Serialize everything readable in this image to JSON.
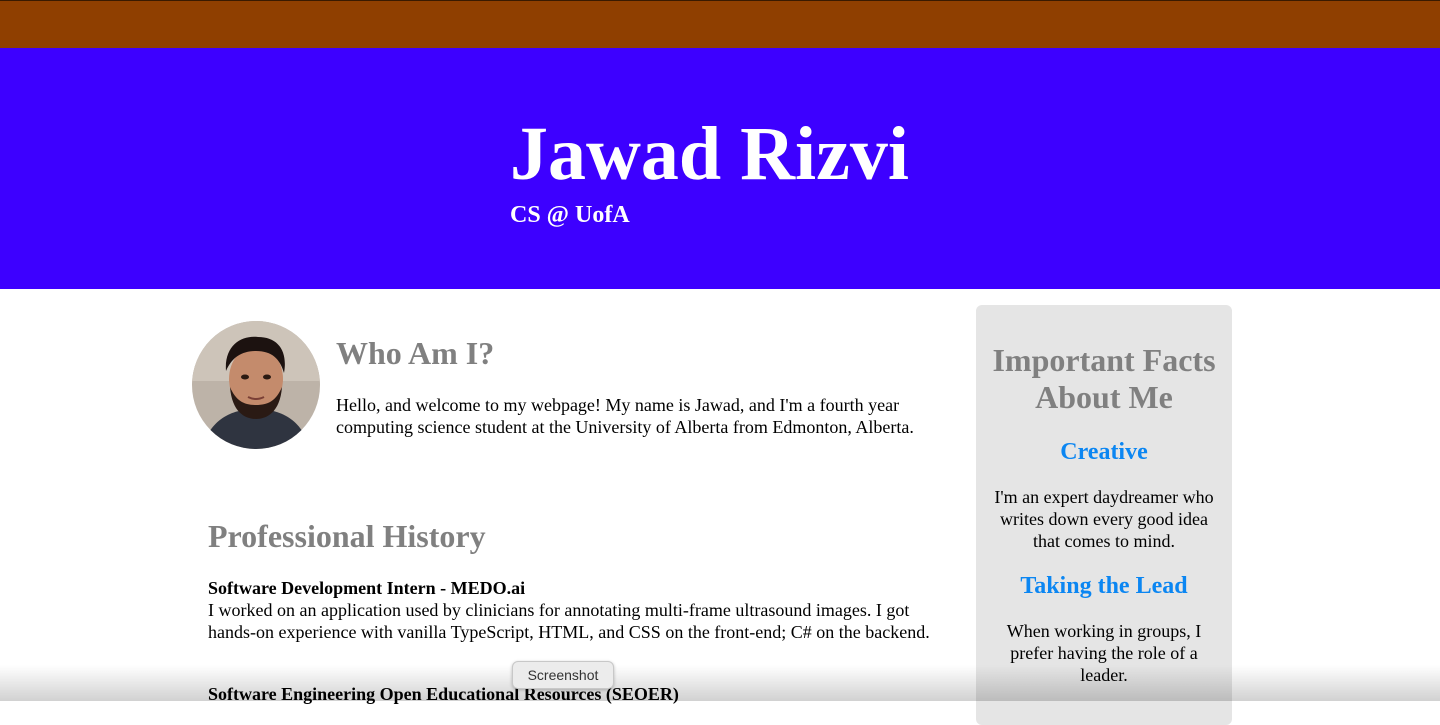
{
  "header": {
    "name": "Jawad Rizvi",
    "subtitle": "CS @ UofA"
  },
  "about": {
    "heading": "Who Am I?",
    "text": "Hello, and welcome to my webpage! My name is Jawad, and I'm a fourth year computing science student at the University of Alberta from Edmonton, Alberta."
  },
  "history": {
    "heading": "Professional History",
    "jobs": [
      {
        "title": "Software Development Intern - MEDO.ai",
        "description": "I worked on an application used by clinicians for annotating multi-frame ultrasound images. I got hands-on experience with vanilla TypeScript, HTML, and CSS on the front-end; C# on the backend."
      },
      {
        "title": "Software Engineering Open Educational Resources (SEOER)",
        "description": ""
      }
    ]
  },
  "facts": {
    "heading": "Important Facts About Me",
    "items": [
      {
        "title": "Creative",
        "text": "I'm an expert daydreamer who writes down every good idea that comes to mind."
      },
      {
        "title": "Taking the Lead",
        "text": "When working in groups, I prefer having the role of a leader."
      }
    ]
  },
  "overlay": {
    "screenshot_label": "Screenshot"
  },
  "colors": {
    "topbar": "#8f3f00",
    "hero": "#3d00ff",
    "heading_gray": "#808080",
    "fact_blue": "#0b86f2",
    "facts_bg": "#e5e5e5"
  }
}
